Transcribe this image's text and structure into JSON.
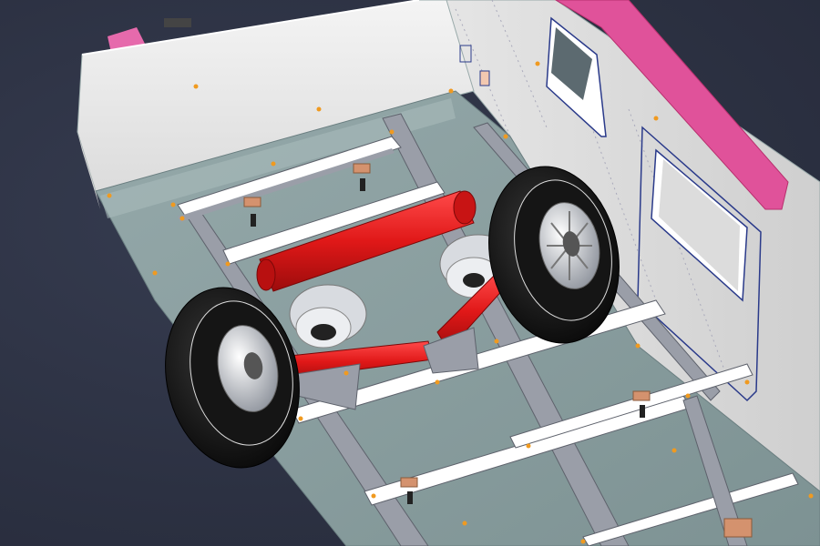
{
  "scene": {
    "subject": "trailer-undercarriage-cad-model",
    "colors": {
      "background": "#2e3344",
      "panel_light": "#f2f2f2",
      "panel_shade": "#d6d6d6",
      "floor": "#8a9fa0",
      "floor_dark": "#6e8384",
      "frame": "#9a9ea8",
      "trim_magenta": "#e0529a",
      "axle_red": "#e01e1e",
      "tire": "#1a1a1a",
      "hub": "#b8bcc4",
      "fastener_orange": "#f09a20",
      "bracket_copper": "#d4926e",
      "edge_blue": "#2a3a8a"
    }
  }
}
